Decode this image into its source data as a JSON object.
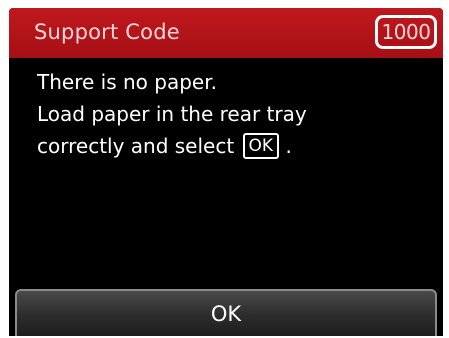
{
  "header": {
    "title": "Support Code",
    "code": "1000"
  },
  "message": {
    "line1": "There is no paper.",
    "line2": "Load paper in the rear tray",
    "line3_prefix": "correctly and select",
    "line3_key": "OK",
    "line3_suffix": "."
  },
  "footer": {
    "ok_label": "OK"
  },
  "colors": {
    "header_red": "#b3141a",
    "header_text": "#ffd6d8",
    "screen_bg": "#000000",
    "text": "#ffffff"
  }
}
